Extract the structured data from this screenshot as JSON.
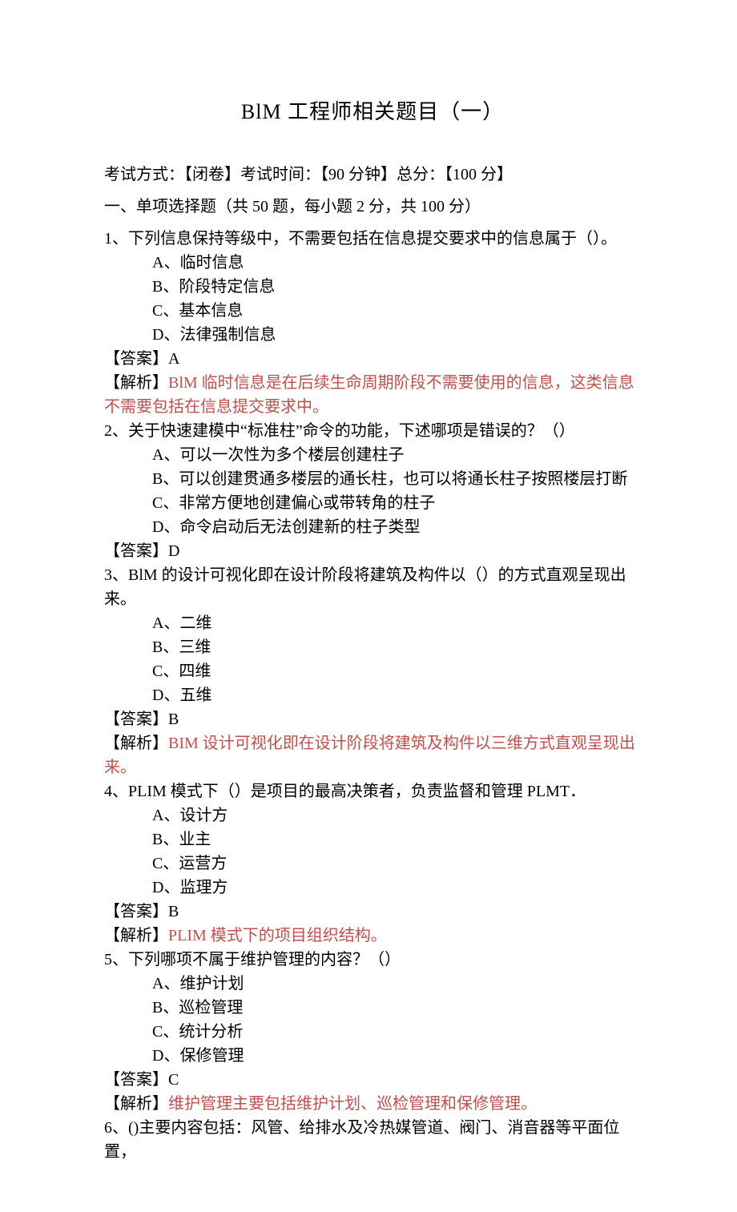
{
  "title": "BlM 工程师相关题目（一）",
  "exam_info": "考试方式：【闭卷】考试时间：【90 分钟】总分：【100 分】",
  "section_header": "一、单项选择题（共 50 题，每小题 2 分，共 100 分）",
  "questions": [
    {
      "stem": "1、下列信息保持等级中，不需要包括在信息提交要求中的信息属于（）。",
      "opts": [
        "A、临时信息",
        "B、阶段特定信息",
        "C、基本信息",
        "D、法律强制信息"
      ],
      "answer": "【答案】A",
      "analysis_label": "【解析】",
      "analysis": "BlM 临时信息是在后续生命周期阶段不需要使用的信息，这类信息不需要包括在信息提交要求中。"
    },
    {
      "stem": "2、关于快速建模中“标准柱”命令的功能，下述哪项是错误的？（）",
      "opts": [
        "A、可以一次性为多个楼层创建柱子",
        "B、可以创建贯通多楼层的通长柱，也可以将通长柱子按照楼层打断",
        "C、非常方便地创建偏心或带转角的柱子",
        "D、命令启动后无法创建新的柱子类型"
      ],
      "answer": "【答案】D",
      "analysis_label": "",
      "analysis": ""
    },
    {
      "stem": "3、BlM 的设计可视化即在设计阶段将建筑及构件以（）的方式直观呈现出来。",
      "opts": [
        "A、二维",
        "B、三维",
        "C、四维",
        "D、五维"
      ],
      "answer": "【答案】B",
      "analysis_label": "【解析】",
      "analysis": "BIM 设计可视化即在设计阶段将建筑及构件以三维方式直观呈现出来。"
    },
    {
      "stem": "4、PLIM 模式下（）是项目的最高决策者，负责监督和管理 PLMT．",
      "opts": [
        "A、设计方",
        "B、业主",
        "C、运营方",
        "D、监理方"
      ],
      "answer": "【答案】B",
      "analysis_label": "【解析】",
      "analysis": "PLIM 模式下的项目组织结构。"
    },
    {
      "stem": "5、下列哪项不属于维护管理的内容？（）",
      "opts": [
        "A、维护计划",
        "B、巡检管理",
        "C、统计分析",
        "D、保修管理"
      ],
      "answer": "【答案】C",
      "analysis_label": "【解析】",
      "analysis": "维护管理主要包括维护计划、巡检管理和保修管理。"
    },
    {
      "stem": "6、()主要内容包括：风管、给排水及冷热媒管道、阀门、消音器等平面位置，",
      "opts": [],
      "answer": "",
      "analysis_label": "",
      "analysis": ""
    }
  ]
}
